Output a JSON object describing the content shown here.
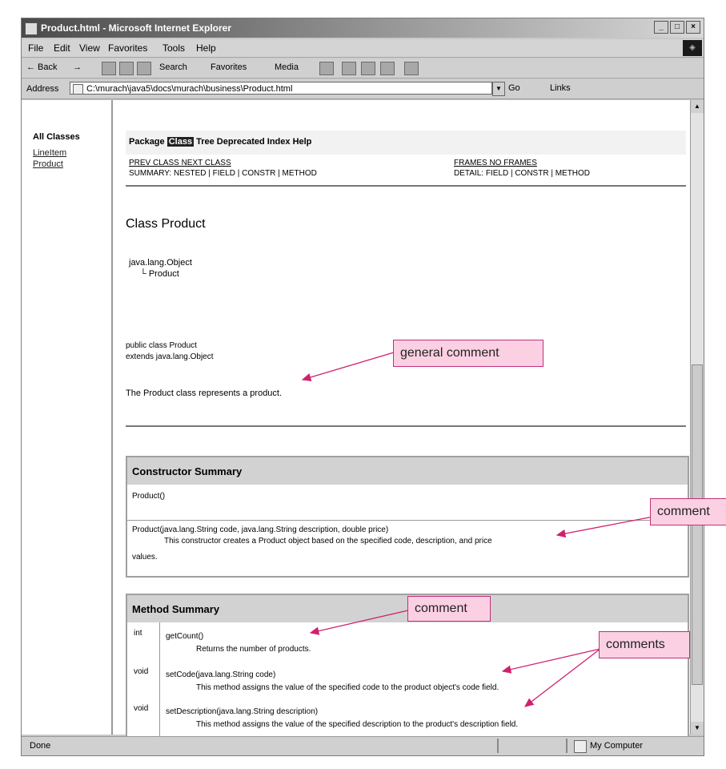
{
  "window": {
    "title": "Product.html - Microsoft Internet Explorer",
    "minimize": "_",
    "maximize": "□",
    "close": "×"
  },
  "menu": {
    "items": [
      "File",
      "Edit",
      "View",
      "Favorites",
      "Tools",
      "Help"
    ]
  },
  "toolbar": {
    "back": "← Back",
    "forward": "→",
    "search": "Search",
    "favorites": "Favorites",
    "media": "Media"
  },
  "address": {
    "label": "Address",
    "value": "C:\\murach\\java5\\docs\\murach\\business\\Product.html",
    "go": "Go",
    "links": "Links"
  },
  "nav_frame": {
    "title": "All Classes",
    "links": [
      "LineItem",
      "Product"
    ]
  },
  "doc": {
    "nav_row": "Package Class Tree Deprecated Index Help",
    "nav_highlight": "Class",
    "prev_next": "PREV CLASS   NEXT CLASS",
    "summary_row": "SUMMARY: NESTED | FIELD | CONSTR | METHOD",
    "frames_row": "FRAMES   NO FRAMES",
    "detail_row": "DETAIL: FIELD | CONSTR | METHOD",
    "class_name": "Class Product",
    "hierarchy": [
      "java.lang.Object",
      "└ Product"
    ],
    "declaration": [
      "public class Product",
      "extends java.lang.Object"
    ],
    "general_comment_text": "The Product class represents a product."
  },
  "constructor_summary": {
    "heading": "Constructor Summary",
    "row1": "Product()",
    "row2": "Product(java.lang.String code, java.lang.String description, double price)",
    "row2_comment": "This constructor creates a Product object based on the specified code, description, and price",
    "row2_wrap": "values."
  },
  "method_summary": {
    "heading": "Method Summary",
    "rows": [
      {
        "type": "int",
        "sig": "getCount()",
        "desc": "Returns the number of products."
      },
      {
        "type": "void",
        "sig": "setCode(java.lang.String code)",
        "desc": "This method assigns the value of the specified code to the product object's code field."
      },
      {
        "type": "void",
        "sig": "setDescription(java.lang.String description)",
        "desc": "This method assigns the value of the specified description to the product's description field."
      }
    ]
  },
  "status": {
    "text": "Done",
    "zone": "My Computer"
  },
  "callouts": {
    "general": "general comment",
    "comment_right": "comment",
    "comment_method": "comment",
    "comments": "comments"
  },
  "colors": {
    "callout_fill": "#fbd0e3",
    "callout_border": "#c0307a",
    "arrow": "#d0206e"
  }
}
